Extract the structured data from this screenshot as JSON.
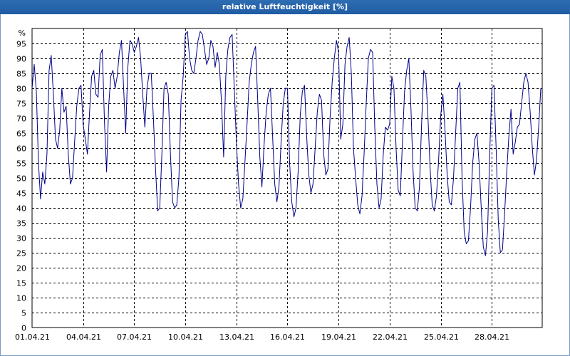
{
  "window": {
    "title": "relative Luftfeuchtigkeit [%]"
  },
  "chart_data": {
    "type": "line",
    "title": "relative Luftfeuchtigkeit [%]",
    "ylabel": "%",
    "xlabel": "",
    "ylim": [
      0,
      100
    ],
    "xlim": [
      "01.04.21 00:00",
      "30.04.21 23:00"
    ],
    "grid": true,
    "legend": "none",
    "series_color": "#00008b",
    "grid_color": "#000000",
    "y_ticks": [
      0,
      5,
      10,
      15,
      20,
      25,
      30,
      35,
      40,
      45,
      50,
      55,
      60,
      65,
      70,
      75,
      80,
      85,
      90,
      95
    ],
    "y_tick_labels": [
      "0",
      "5",
      "10",
      "15",
      "20",
      "25",
      "30",
      "35",
      "40",
      "45",
      "50",
      "55",
      "60",
      "65",
      "70",
      "75",
      "80",
      "85",
      "90",
      "95"
    ],
    "x_tick_labels": [
      "01.04.21",
      "04.04.21",
      "07.04.21",
      "10.04.21",
      "13.04.21",
      "16.04.21",
      "19.04.21",
      "22.04.21",
      "25.04.21",
      "28.04.21"
    ],
    "x_tick_dates": [
      "01.04.21",
      "04.04.21",
      "07.04.21",
      "10.04.21",
      "13.04.21",
      "16.04.21",
      "19.04.21",
      "22.04.21",
      "25.04.21",
      "28.04.21"
    ],
    "series": [
      {
        "x": [
          "01.04.21 00:00",
          "01.04.21 03:00",
          "01.04.21 06:00",
          "01.04.21 09:00",
          "01.04.21 12:00",
          "01.04.21 15:00",
          "01.04.21 18:00",
          "01.04.21 21:00",
          "02.04.21 00:00",
          "02.04.21 03:00",
          "02.04.21 06:00",
          "02.04.21 09:00",
          "02.04.21 12:00",
          "02.04.21 15:00",
          "02.04.21 18:00",
          "02.04.21 21:00",
          "03.04.21 00:00",
          "03.04.21 03:00",
          "03.04.21 06:00",
          "03.04.21 09:00",
          "03.04.21 12:00",
          "03.04.21 15:00",
          "03.04.21 18:00",
          "03.04.21 21:00",
          "04.04.21 00:00",
          "04.04.21 03:00",
          "04.04.21 06:00",
          "04.04.21 09:00",
          "04.04.21 12:00",
          "04.04.21 15:00",
          "04.04.21 18:00",
          "04.04.21 21:00",
          "05.04.21 00:00",
          "05.04.21 03:00",
          "05.04.21 06:00",
          "05.04.21 09:00",
          "05.04.21 12:00",
          "05.04.21 15:00",
          "05.04.21 18:00",
          "05.04.21 21:00",
          "06.04.21 00:00",
          "06.04.21 03:00",
          "06.04.21 06:00",
          "06.04.21 09:00",
          "06.04.21 12:00",
          "06.04.21 15:00",
          "06.04.21 18:00",
          "06.04.21 21:00",
          "07.04.21 00:00",
          "07.04.21 03:00",
          "07.04.21 06:00",
          "07.04.21 09:00",
          "07.04.21 12:00",
          "07.04.21 15:00",
          "07.04.21 18:00",
          "07.04.21 21:00",
          "08.04.21 00:00",
          "08.04.21 03:00",
          "08.04.21 06:00",
          "08.04.21 09:00",
          "08.04.21 12:00",
          "08.04.21 15:00",
          "08.04.21 18:00",
          "08.04.21 21:00",
          "09.04.21 00:00",
          "09.04.21 03:00",
          "09.04.21 06:00",
          "09.04.21 09:00",
          "09.04.21 12:00",
          "09.04.21 15:00",
          "09.04.21 18:00",
          "09.04.21 21:00",
          "10.04.21 00:00",
          "10.04.21 03:00",
          "10.04.21 06:00",
          "10.04.21 09:00",
          "10.04.21 12:00",
          "10.04.21 15:00",
          "10.04.21 18:00",
          "10.04.21 21:00",
          "11.04.21 00:00",
          "11.04.21 03:00",
          "11.04.21 06:00",
          "11.04.21 09:00",
          "11.04.21 12:00",
          "11.04.21 15:00",
          "11.04.21 18:00",
          "11.04.21 21:00",
          "12.04.21 00:00",
          "12.04.21 03:00",
          "12.04.21 06:00",
          "12.04.21 09:00",
          "12.04.21 12:00",
          "12.04.21 15:00",
          "12.04.21 18:00",
          "12.04.21 21:00",
          "13.04.21 00:00",
          "13.04.21 03:00",
          "13.04.21 06:00",
          "13.04.21 09:00",
          "13.04.21 12:00",
          "13.04.21 15:00",
          "13.04.21 18:00",
          "13.04.21 21:00",
          "14.04.21 00:00",
          "14.04.21 03:00",
          "14.04.21 06:00",
          "14.04.21 09:00",
          "14.04.21 12:00",
          "14.04.21 15:00",
          "14.04.21 18:00",
          "14.04.21 21:00",
          "15.04.21 00:00",
          "15.04.21 03:00",
          "15.04.21 06:00",
          "15.04.21 09:00",
          "15.04.21 12:00",
          "15.04.21 15:00",
          "15.04.21 18:00",
          "15.04.21 21:00",
          "16.04.21 00:00",
          "16.04.21 03:00",
          "16.04.21 06:00",
          "16.04.21 09:00",
          "16.04.21 12:00",
          "16.04.21 15:00",
          "16.04.21 18:00",
          "16.04.21 21:00",
          "17.04.21 00:00",
          "17.04.21 03:00",
          "17.04.21 06:00",
          "17.04.21 09:00",
          "17.04.21 12:00",
          "17.04.21 15:00",
          "17.04.21 18:00",
          "17.04.21 21:00",
          "18.04.21 00:00",
          "18.04.21 03:00",
          "18.04.21 06:00",
          "18.04.21 09:00",
          "18.04.21 12:00",
          "18.04.21 15:00",
          "18.04.21 18:00",
          "18.04.21 21:00",
          "19.04.21 00:00",
          "19.04.21 03:00",
          "19.04.21 06:00",
          "19.04.21 09:00",
          "19.04.21 12:00",
          "19.04.21 15:00",
          "19.04.21 18:00",
          "19.04.21 21:00",
          "20.04.21 00:00",
          "20.04.21 03:00",
          "20.04.21 06:00",
          "20.04.21 09:00",
          "20.04.21 12:00",
          "20.04.21 15:00",
          "20.04.21 18:00",
          "20.04.21 21:00",
          "21.04.21 00:00",
          "21.04.21 03:00",
          "21.04.21 06:00",
          "21.04.21 09:00",
          "21.04.21 12:00",
          "21.04.21 15:00",
          "21.04.21 18:00",
          "21.04.21 21:00",
          "22.04.21 00:00",
          "22.04.21 03:00",
          "22.04.21 06:00",
          "22.04.21 09:00",
          "22.04.21 12:00",
          "22.04.21 15:00",
          "22.04.21 18:00",
          "22.04.21 21:00",
          "23.04.21 00:00",
          "23.04.21 03:00",
          "23.04.21 06:00",
          "23.04.21 09:00",
          "23.04.21 12:00",
          "23.04.21 15:00",
          "23.04.21 18:00",
          "23.04.21 21:00",
          "24.04.21 00:00",
          "24.04.21 03:00",
          "24.04.21 06:00",
          "24.04.21 09:00",
          "24.04.21 12:00",
          "24.04.21 15:00",
          "24.04.21 18:00",
          "24.04.21 21:00",
          "25.04.21 00:00",
          "25.04.21 03:00",
          "25.04.21 06:00",
          "25.04.21 09:00",
          "25.04.21 12:00",
          "25.04.21 15:00",
          "25.04.21 18:00",
          "25.04.21 21:00",
          "26.04.21 00:00",
          "26.04.21 03:00",
          "26.04.21 06:00",
          "26.04.21 09:00",
          "26.04.21 12:00",
          "26.04.21 15:00",
          "26.04.21 18:00",
          "26.04.21 21:00",
          "27.04.21 00:00",
          "27.04.21 03:00",
          "27.04.21 06:00",
          "27.04.21 09:00",
          "27.04.21 12:00",
          "27.04.21 15:00",
          "27.04.21 18:00",
          "27.04.21 21:00",
          "28.04.21 00:00",
          "28.04.21 03:00",
          "28.04.21 06:00",
          "28.04.21 09:00",
          "28.04.21 12:00",
          "28.04.21 15:00",
          "28.04.21 18:00",
          "28.04.21 21:00",
          "29.04.21 00:00",
          "29.04.21 03:00",
          "29.04.21 06:00",
          "29.04.21 09:00",
          "29.04.21 12:00",
          "29.04.21 15:00",
          "29.04.21 18:00",
          "29.04.21 21:00",
          "30.04.21 00:00",
          "30.04.21 03:00",
          "30.04.21 06:00",
          "30.04.21 09:00",
          "30.04.21 12:00",
          "30.04.21 15:00",
          "30.04.21 18:00",
          "30.04.21 21:00"
        ],
        "values": [
          80,
          88,
          79,
          55,
          43,
          52,
          48,
          58,
          86,
          91,
          78,
          63,
          60,
          66,
          80,
          72,
          74,
          58,
          48,
          50,
          62,
          74,
          80,
          81,
          68,
          63,
          58,
          72,
          84,
          86,
          78,
          77,
          91,
          93,
          69,
          52,
          74,
          84,
          86,
          80,
          84,
          92,
          96,
          80,
          65,
          87,
          96,
          95,
          92,
          94,
          97,
          90,
          78,
          67,
          80,
          85,
          85,
          70,
          53,
          39,
          40,
          58,
          80,
          82,
          78,
          58,
          42,
          40,
          41,
          50,
          76,
          84,
          98,
          99,
          90,
          86,
          85,
          90,
          96,
          99,
          98,
          93,
          88,
          90,
          96,
          94,
          87,
          92,
          88,
          75,
          57,
          84,
          93,
          97,
          98,
          80,
          62,
          48,
          40,
          43,
          55,
          68,
          82,
          88,
          92,
          94,
          76,
          57,
          47,
          61,
          72,
          78,
          80,
          64,
          48,
          42,
          47,
          62,
          75,
          80,
          80,
          55,
          42,
          37,
          40,
          52,
          71,
          79,
          81,
          64,
          51,
          45,
          48,
          60,
          72,
          78,
          76,
          58,
          51,
          53,
          70,
          82,
          90,
          96,
          92,
          63,
          68,
          88,
          94,
          97,
          85,
          60,
          50,
          41,
          38,
          44,
          58,
          75,
          90,
          93,
          92,
          67,
          48,
          40,
          43,
          58,
          67,
          66,
          68,
          84,
          80,
          60,
          46,
          44,
          62,
          79,
          86,
          90,
          73,
          52,
          40,
          39,
          47,
          68,
          86,
          84,
          70,
          53,
          41,
          39,
          44,
          56,
          71,
          78,
          66,
          51,
          42,
          41,
          50,
          65,
          80,
          82,
          50,
          32,
          28,
          29,
          40,
          55,
          63,
          65,
          55,
          40,
          27,
          24,
          32,
          58,
          80,
          81,
          60,
          36,
          25,
          26,
          38,
          52,
          64,
          73,
          58,
          62,
          67,
          68,
          75,
          82,
          85,
          82,
          72,
          60,
          51,
          56,
          67,
          80
        ]
      }
    ]
  }
}
